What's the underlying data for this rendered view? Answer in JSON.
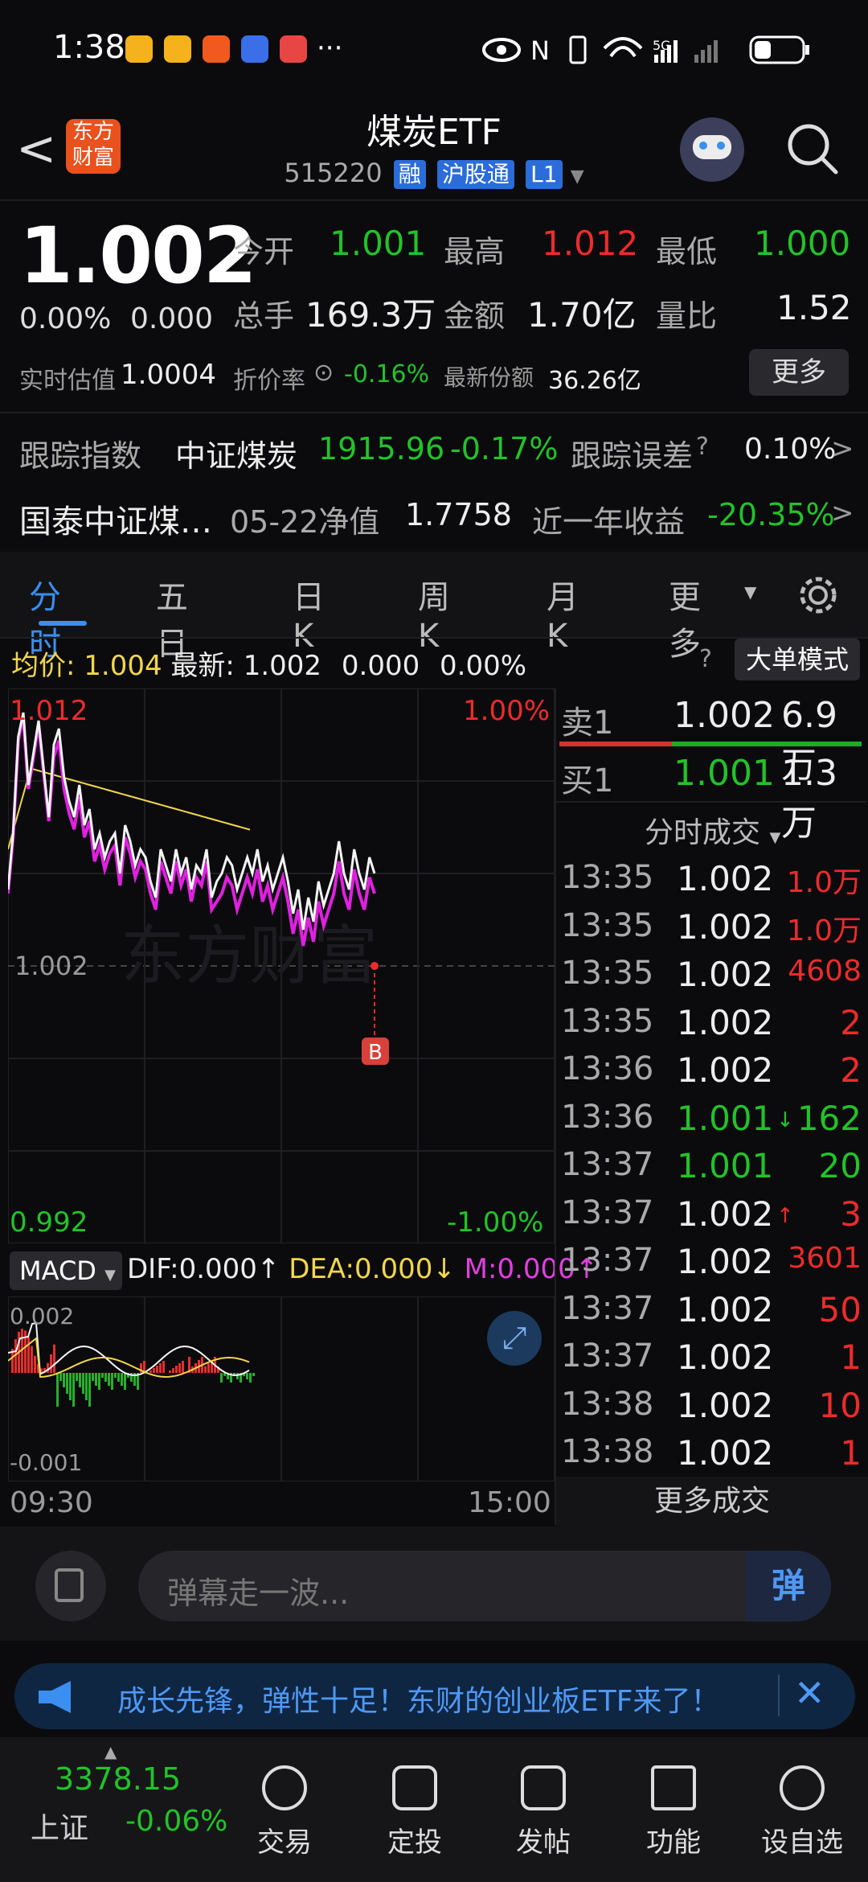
{
  "status_bar": {
    "time": "1:38",
    "dots": "···",
    "network": "5G"
  },
  "header": {
    "back_label": "<",
    "brand": "东方财富",
    "title": "煤炭ETF",
    "code": "515220",
    "tags": [
      "融",
      "沪股通",
      "L1"
    ]
  },
  "quote": {
    "price": "1.002",
    "change_pct": "0.00%",
    "change": "0.000",
    "open_label": "今开",
    "open": "1.001",
    "high_label": "最高",
    "high": "1.012",
    "low_label": "最低",
    "low": "1.000",
    "volume_label": "总手",
    "volume": "169.3万",
    "amount_label": "金额",
    "amount": "1.70亿",
    "ratio_label": "量比",
    "ratio": "1.52",
    "iopv_label": "实时估值",
    "iopv": "1.0004",
    "discount_label": "折价率",
    "discount": "-0.16%",
    "shares_label": "最新份额",
    "shares": "36.26亿",
    "more_button": "更多"
  },
  "tracking": {
    "index_label": "跟踪指数",
    "index_name": "中证煤炭",
    "index_value": "1915.96",
    "index_change": "-0.17%",
    "error_label": "跟踪误差",
    "error_value": "0.10%"
  },
  "fund": {
    "name": "国泰中证煤…",
    "nav_label": "05-22净值",
    "nav": "1.7758",
    "year_label": "近一年收益",
    "year_return": "-20.35%"
  },
  "tabs": [
    "分时",
    "五日",
    "日K",
    "周K",
    "月K",
    "更多"
  ],
  "chart_info": {
    "avg_label": "均价:",
    "avg": "1.004",
    "last_label": "最新:",
    "last": "1.002",
    "chg": "0.000",
    "pct": "0.00%",
    "mode_button": "大单模式",
    "y_top": "1.012",
    "y_bottom": "0.992",
    "pct_top": "1.00%",
    "pct_bottom": "-1.00%",
    "mid_label": "1.002",
    "x_start": "09:30",
    "x_end": "15:00",
    "macd_label": "MACD",
    "dif": "DIF:0.000",
    "dea": "DEA:0.000",
    "m": "M:0.000",
    "macd_top": "0.002",
    "macd_bottom": "-0.001",
    "watermark": "东方财富",
    "b_marker": "B"
  },
  "order_book": {
    "sell1_label": "卖1",
    "sell1_price": "1.002",
    "sell1_vol": "6.9万",
    "buy1_label": "买1",
    "buy1_price": "1.001",
    "buy1_vol": "1.3万",
    "ticks_label": "分时成交",
    "more_trades": "更多成交"
  },
  "ticks": [
    {
      "time": "13:35",
      "price": "1.002",
      "vol": "1.0万",
      "pc": "white",
      "vc": "red",
      "arrow": ""
    },
    {
      "time": "13:35",
      "price": "1.002",
      "vol": "1.0万",
      "pc": "white",
      "vc": "red",
      "arrow": ""
    },
    {
      "time": "13:35",
      "price": "1.002",
      "vol": "4608",
      "pc": "white",
      "vc": "red",
      "arrow": ""
    },
    {
      "time": "13:35",
      "price": "1.002",
      "vol": "2",
      "pc": "white",
      "vc": "red",
      "arrow": ""
    },
    {
      "time": "13:36",
      "price": "1.002",
      "vol": "2",
      "pc": "white",
      "vc": "red",
      "arrow": ""
    },
    {
      "time": "13:36",
      "price": "1.001",
      "vol": "162",
      "pc": "green",
      "vc": "green",
      "arrow": "↓"
    },
    {
      "time": "13:37",
      "price": "1.001",
      "vol": "20",
      "pc": "green",
      "vc": "green",
      "arrow": ""
    },
    {
      "time": "13:37",
      "price": "1.002",
      "vol": "3",
      "pc": "white",
      "vc": "red",
      "arrow": "↑"
    },
    {
      "time": "13:37",
      "price": "1.002",
      "vol": "3601",
      "pc": "white",
      "vc": "red",
      "arrow": ""
    },
    {
      "time": "13:37",
      "price": "1.002",
      "vol": "50",
      "pc": "white",
      "vc": "red",
      "arrow": ""
    },
    {
      "time": "13:37",
      "price": "1.002",
      "vol": "1",
      "pc": "white",
      "vc": "red",
      "arrow": ""
    },
    {
      "time": "13:38",
      "price": "1.002",
      "vol": "10",
      "pc": "white",
      "vc": "red",
      "arrow": ""
    },
    {
      "time": "13:38",
      "price": "1.002",
      "vol": "1",
      "pc": "white",
      "vc": "red",
      "arrow": ""
    }
  ],
  "comment": {
    "placeholder": "弹幕走一波...",
    "danmu": "弹"
  },
  "banner": {
    "text": "成长先锋，弹性十足！东财的创业板ETF来了！"
  },
  "bottom_nav": {
    "index_value": "3378.15",
    "index_name": "上证",
    "index_change": "-0.06%",
    "items": [
      "交易",
      "定投",
      "发帖",
      "功能",
      "设自选"
    ]
  },
  "colors": {
    "up": "#ee2b2b",
    "down": "#22c22a",
    "accent": "#3a8ff0",
    "avg": "#f2d64b"
  }
}
